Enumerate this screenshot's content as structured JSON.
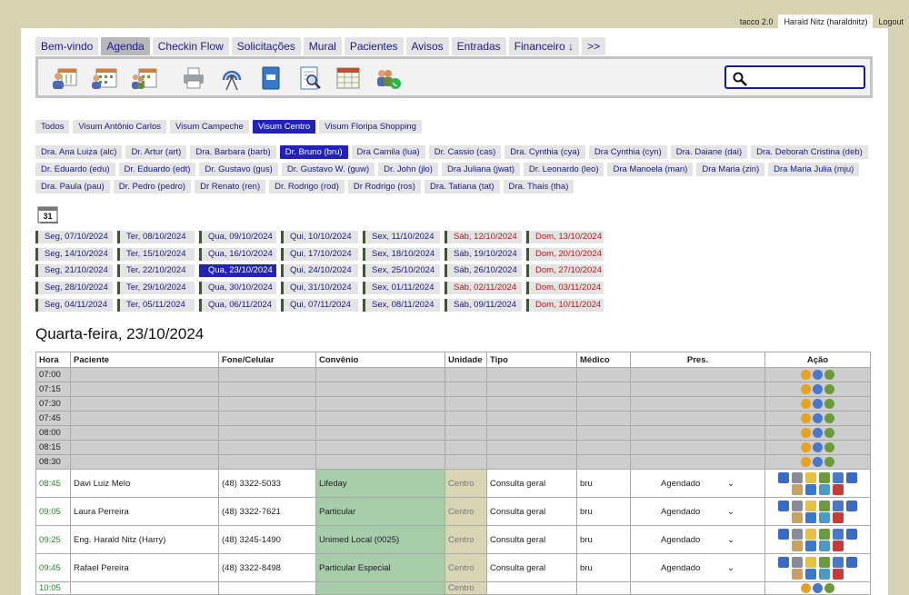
{
  "topbar": {
    "version": "tacco 2.0",
    "user": "Harald Nitz (haraldnitz)",
    "logout": "Logout"
  },
  "tabs": [
    "Bem-vindo",
    "Agenda",
    "Checkin Flow",
    "Solicitações",
    "Mural",
    "Pacientes",
    "Avisos",
    "Entradas",
    "Financeiro ↓",
    ">>"
  ],
  "active_tab": "Agenda",
  "toolbar_icons": [
    "patients-schedule-icon",
    "schedule-icon",
    "group-schedule-icon",
    "printer-icon",
    "broadcast-icon",
    "notebook-icon",
    "document-search-icon",
    "calendar-grid-icon",
    "whatsapp-group-icon"
  ],
  "locations": [
    "Todos",
    "Visum Antônio Carlos",
    "Visum Campeche",
    "Visum Centro",
    "Visum Floripa Shopping"
  ],
  "selected_location": "Visum Centro",
  "doctors": [
    [
      "Dra. Ana Luiza (alc)",
      "Dr. Artur (art)",
      "Dra. Barbara (barb)",
      "Dr. Bruno (bru)",
      "Dra Camila (lua)",
      "Dr. Cassio (cas)",
      "Dra. Cynthia (cya)",
      "Dra Cynthia (cyn)",
      "Dra. Daiane (dai)",
      "Dra. Deborah Cristina (deb)"
    ],
    [
      "Dr. Eduardo (edu)",
      "Dr. Eduardo (edt)",
      "Dr. Gustavo (gus)",
      "Dr. Gustavo W. (guw)",
      "Dr. John (jlo)",
      "Dra Juliana (jwat)",
      "Dr. Leonardo (leo)",
      "Dra Manoela (man)",
      "Dra Maria (zin)",
      "Dra Maria Julia (mju)"
    ],
    [
      "Dra. Paula (pau)",
      "Dr. Pedro (pedro)",
      "Dr Renato (ren)",
      "Dr. Rodrigo (rod)",
      "Dr Rodrigo (ros)",
      "Dra. Tatiana (tat)",
      "Dra. Thais (tha)"
    ]
  ],
  "selected_doctor": "Dr. Bruno (bru)",
  "calendar_icon_label": "31",
  "weeks": [
    [
      "Seg, 07/10/2024",
      "Ter, 08/10/2024",
      "Qua, 09/10/2024",
      "Qui, 10/10/2024",
      "Sex, 11/10/2024",
      "Sáb, 12/10/2024",
      "Dom, 13/10/2024"
    ],
    [
      "Seg, 14/10/2024",
      "Ter, 15/10/2024",
      "Qua, 16/10/2024",
      "Qui, 17/10/2024",
      "Sex, 18/10/2024",
      "Sáb, 19/10/2024",
      "Dom, 20/10/2024"
    ],
    [
      "Seg, 21/10/2024",
      "Ter, 22/10/2024",
      "Qua, 23/10/2024",
      "Qui, 24/10/2024",
      "Sex, 25/10/2024",
      "Sáb, 26/10/2024",
      "Dom, 27/10/2024"
    ],
    [
      "Seg, 28/10/2024",
      "Ter, 29/10/2024",
      "Qua, 30/10/2024",
      "Qui, 31/10/2024",
      "Sex, 01/11/2024",
      "Sáb, 02/11/2024",
      "Dom, 03/11/2024"
    ],
    [
      "Seg, 04/11/2024",
      "Ter, 05/11/2024",
      "Qua, 06/11/2024",
      "Qui, 07/11/2024",
      "Sex, 08/11/2024",
      "Sáb, 09/11/2024",
      "Dom, 10/11/2024"
    ]
  ],
  "weekend_red": [
    "Sáb, 12/10/2024",
    "Dom, 13/10/2024",
    "Dom, 20/10/2024",
    "Dom, 27/10/2024",
    "Sáb, 02/11/2024",
    "Dom, 03/11/2024",
    "Dom, 10/11/2024"
  ],
  "selected_day": "Qua, 23/10/2024",
  "date_title": "Quarta-feira, 23/10/2024",
  "table": {
    "headers": [
      "Hora",
      "Paciente",
      "Fone/Celular",
      "Convênio",
      "Unidade",
      "Tipo",
      "Médico",
      "Pres.",
      "Ação"
    ],
    "empty_slots": [
      "07:00",
      "07:15",
      "07:30",
      "07:45",
      "08:00",
      "08:15",
      "08:30"
    ],
    "appointments": [
      {
        "hora": "08:45",
        "paciente": "Davi Luiz Melo",
        "fone": "(48) 3322-5033",
        "convenio": "Lifeday",
        "unidade": "Centro",
        "tipo": "Consulta geral",
        "medico": "bru",
        "pres": "Agendado"
      },
      {
        "hora": "09:05",
        "paciente": "Laura Perreira",
        "fone": "(48) 3322-7621",
        "convenio": "Particular",
        "unidade": "Centro",
        "tipo": "Consulta geral",
        "medico": "bru",
        "pres": "Agendado"
      },
      {
        "hora": "09:25",
        "paciente": "Eng. Harald Nitz (Harry)",
        "fone": "(48) 3245-1490",
        "convenio": "Unimed Local (0025)",
        "unidade": "Centro",
        "tipo": "Consulta geral",
        "medico": "bru",
        "pres": "Agendado"
      },
      {
        "hora": "09:45",
        "paciente": "Rafael Pereira",
        "fone": "(48) 3322-8498",
        "convenio": "Particular Especial",
        "unidade": "Centro",
        "tipo": "Consulta geral",
        "medico": "bru",
        "pres": "Agendado"
      }
    ],
    "last_row": {
      "hora": "10:05",
      "unidade": "Centro"
    },
    "dropdown_glyph": "⌄"
  },
  "colors": {
    "accent": "#2222b8",
    "link": "#1a1a8a",
    "weekend": "#b81818",
    "convenio_bg": "#a6ccaa",
    "unidade_bg": "#d8d4b4",
    "hora_green": "#2a8a2a",
    "page_bg": "#d6d2b2"
  }
}
